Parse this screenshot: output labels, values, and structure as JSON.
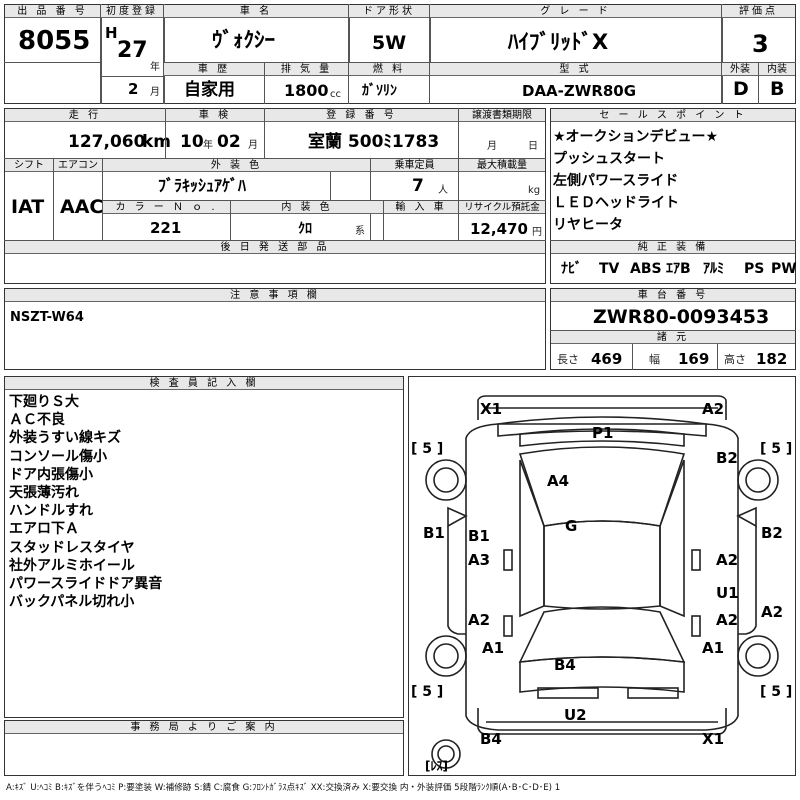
{
  "header": {
    "lot_no_label": "出 品 番 号",
    "lot_no": "8055",
    "first_reg_label": "初度登録",
    "first_reg_era": "H",
    "first_reg_year": "27",
    "year_unit": "年",
    "first_reg_month": "2",
    "month_unit": "月",
    "car_name_label": "車 名",
    "car_name": "ｳﾞｫｸｼｰ",
    "door_label": "ドア形状",
    "door": "5W",
    "grade_label": "グ レ ー ド",
    "grade": "ﾊｲﾌﾞﾘｯﾄﾞX",
    "score_label": "評価点",
    "score": "3",
    "history_label": "車 歴",
    "history": "自家用",
    "displacement_label": "排 気 量",
    "displacement": "1800",
    "displacement_unit": "cc",
    "fuel_label": "燃 料",
    "fuel": "ｶﾞｿﾘﾝ",
    "model_code_label": "型 式",
    "model_code": "DAA-ZWR80G",
    "exterior_label": "外装",
    "exterior": "D",
    "interior_label": "内装",
    "interior": "B"
  },
  "row2": {
    "mileage_label": "走 行",
    "mileage": "127,060",
    "mileage_unit": "km",
    "inspection_label": "車 検",
    "insp_year": "10",
    "insp_month": "02",
    "year_unit": "年",
    "month_unit": "月",
    "reg_no_label": "登 録 番 号",
    "reg_no": "室蘭 500ﾐ1783",
    "transfer_label": "譲渡書類期限",
    "transfer_month_unit": "月",
    "transfer_day_unit": "日",
    "shift_label": "シフト",
    "shift": "IAT",
    "ac_label": "エアコン",
    "ac": "AAC",
    "color_label": "外 装 色",
    "color": "ﾌﾞﾗｷｯｼｭｱｹﾞﾊ",
    "capacity_label": "乗車定員",
    "capacity": "7",
    "capacity_unit": "人",
    "load_label": "最大積載量",
    "load_unit": "kg",
    "color_no_label": "カ ラ ー Ｎ ｏ .",
    "color_no": "221",
    "int_color_label": "内 装 色",
    "int_color": "ｸﾛ",
    "int_color_unit": "系",
    "import_label": "輸 入 車",
    "recycle_label": "リサイクル預託金",
    "recycle": "12,470",
    "recycle_unit": "円",
    "later_parts_label": "後 日 発 送 部 品"
  },
  "sales_points": {
    "label": "セ ー ル ス ポ イ ン ト",
    "items": [
      "★オークションデビュー★",
      "プッシュスタート",
      "左側パワースライド",
      "ＬＥＤヘッドライト",
      "リヤヒータ"
    ]
  },
  "equipment": {
    "label": "純 正 装 備",
    "items": [
      "ﾅﾋﾞ",
      "TV",
      "ABS",
      "ｴｱB",
      "ｱﾙﾐ",
      "PS",
      "PW"
    ]
  },
  "caution": {
    "label": "注 意 事 項 欄",
    "text": "NSZT-W64"
  },
  "chassis": {
    "label": "車 台 番 号",
    "number": "ZWR80-0093453",
    "spec_label": "諸 元",
    "length_label": "長さ",
    "length": "469",
    "width_label": "幅",
    "width": "169",
    "height_label": "高さ",
    "height": "182"
  },
  "inspector": {
    "label": "検 査 員 記 入 欄",
    "notes": [
      "下廻りＳ大",
      "ＡＣ不良",
      "外装うすい線キズ",
      "コンソール傷小",
      "ドア内張傷小",
      "天張薄汚れ",
      "ハンドルすれ",
      "エアロ下Ａ",
      "スタッドレスタイヤ",
      "社外アルミホイール",
      "パワースライドドア異音",
      "バックパネル切れ小"
    ]
  },
  "office": {
    "label": "事 務 局 よ り ご 案 内"
  },
  "diagram": {
    "tires": [
      "[ 5 ]",
      "[ 5 ]",
      "[ 5 ]",
      "[ 5 ]"
    ],
    "spare": "[ﾚｽ]",
    "marks": [
      "X1",
      "A2",
      "P1",
      "B2",
      "A4",
      "B1",
      "B2",
      "B1",
      "G",
      "A3",
      "A2",
      "U1",
      "A2",
      "A2",
      "A2",
      "A1",
      "A1",
      "B4",
      "U2",
      "B4",
      "X1"
    ]
  },
  "legend": "A:ｷｽﾞ U:ﾍｺﾐ B:ｷｽﾞを伴うﾍｺﾐ P:要塗装 W:補修跡 S:錆 C:腐食 G:ﾌﾛﾝﾄｶﾞﾗｽ点ｷｽﾞ XX:交換済み X:要交換 内・外装評価 5段階ﾗﾝｸ順(A･B･C･D･E) 1"
}
